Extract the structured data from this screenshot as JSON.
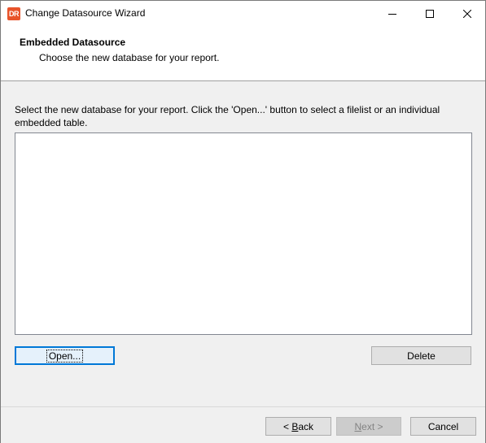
{
  "window": {
    "title": "Change Datasource Wizard",
    "app_icon_text": "DR",
    "app_icon_color": "#e8542b"
  },
  "header": {
    "title": "Embedded Datasource",
    "subtitle": "Choose the new database for your report."
  },
  "main": {
    "instruction": "Select the new database for your report. Click the 'Open...' button to select a filelist or an individual embedded table.",
    "datasource_list": {
      "items": []
    },
    "open_label": "Open...",
    "delete_label": "Delete"
  },
  "footer": {
    "back_prefix": "< ",
    "back_accel": "B",
    "back_rest": "ack",
    "next_accel": "N",
    "next_rest": "ext >",
    "cancel_label": "Cancel"
  },
  "colors": {
    "accent": "#0078d7",
    "button_face": "#e1e1e1",
    "disabled_text": "#838383"
  }
}
